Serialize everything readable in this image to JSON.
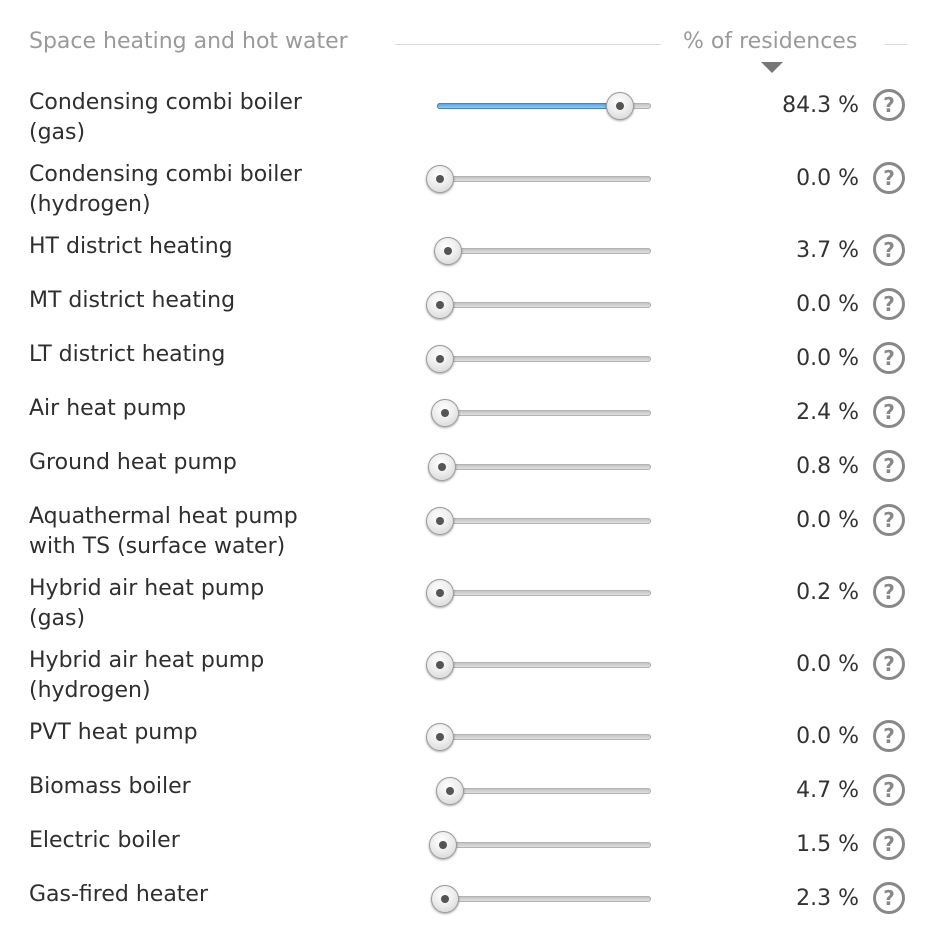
{
  "header": {
    "title": "Space heating and hot water",
    "unit_column": "% of residences",
    "sort_icon": "triangle-down-icon"
  },
  "help_glyph": "?",
  "colors": {
    "slider_fill": "#5aa6e6",
    "help_icon": "#888888",
    "muted_text": "#9a9a9a"
  },
  "rows": [
    {
      "label_lines": [
        "Condensing combi boiler",
        "(gas)"
      ],
      "value": "84.3 %",
      "level_percent": 84.3
    },
    {
      "label_lines": [
        "Condensing combi boiler",
        "(hydrogen)"
      ],
      "value": "0.0 %",
      "level_percent": 0.0
    },
    {
      "label_lines": [
        "HT district heating"
      ],
      "value": "3.7 %",
      "level_percent": 3.7
    },
    {
      "label_lines": [
        "MT district heating"
      ],
      "value": "0.0 %",
      "level_percent": 0.0
    },
    {
      "label_lines": [
        "LT district heating"
      ],
      "value": "0.0 %",
      "level_percent": 0.0
    },
    {
      "label_lines": [
        "Air heat pump"
      ],
      "value": "2.4 %",
      "level_percent": 2.4
    },
    {
      "label_lines": [
        "Ground heat pump"
      ],
      "value": "0.8 %",
      "level_percent": 0.8
    },
    {
      "label_lines": [
        "Aquathermal heat pump",
        "with TS (surface water)"
      ],
      "value": "0.0 %",
      "level_percent": 0.0
    },
    {
      "label_lines": [
        "Hybrid air heat pump",
        "(gas)"
      ],
      "value": "0.2 %",
      "level_percent": 0.2
    },
    {
      "label_lines": [
        "Hybrid air heat pump",
        "(hydrogen)"
      ],
      "value": "0.0 %",
      "level_percent": 0.0
    },
    {
      "label_lines": [
        "PVT heat pump"
      ],
      "value": "0.0 %",
      "level_percent": 0.0
    },
    {
      "label_lines": [
        "Biomass boiler"
      ],
      "value": "4.7 %",
      "level_percent": 4.7
    },
    {
      "label_lines": [
        "Electric boiler"
      ],
      "value": "1.5 %",
      "level_percent": 1.5
    },
    {
      "label_lines": [
        "Gas-fired heater"
      ],
      "value": "2.3 %",
      "level_percent": 2.3
    }
  ]
}
